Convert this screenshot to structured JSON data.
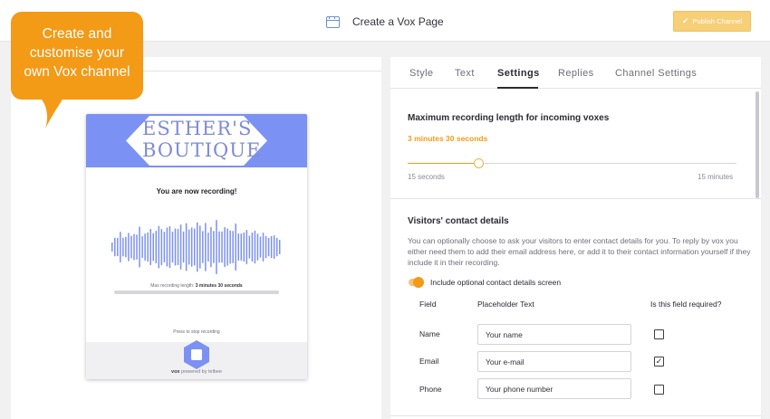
{
  "header": {
    "title": "Create a Vox Page",
    "publish_label": "Publish Channel",
    "title_icon": "browser-window-icon",
    "publish_icon": "check-icon"
  },
  "callout": {
    "lines": [
      "Create and",
      "customise your",
      "own Vox channel"
    ],
    "color": "#f39a17"
  },
  "preview": {
    "brand_line1": "ESTHER'S",
    "brand_line2": "BOUTIQUE",
    "recording_status": "You are now recording!",
    "max_length_label": "Max recording length:",
    "max_length_value": "3 minutes 30 seconds",
    "press_to_stop": "Press to stop recording",
    "powered_brand": "vox",
    "powered_by": "powered by telbee",
    "accent_color": "#7b91f3"
  },
  "settings": {
    "tabs": [
      "Style",
      "Text",
      "Settings",
      "Replies",
      "Channel Settings"
    ],
    "active_tab": "Settings",
    "recording": {
      "title": "Maximum recording length for incoming voxes",
      "value_label": "3 minutes 30 seconds",
      "slider_min": "15 seconds",
      "slider_max": "15 minutes",
      "slider_fraction": 0.217
    },
    "contact": {
      "title": "Visitors' contact details",
      "description": "You can optionally choose to ask your visitors to enter contact details for you. To reply by vox you either need them to add their email address here, or add it to their contact information yourself if they include it in their recording.",
      "toggle_label": "Include optional contact details screen",
      "toggle_on": true,
      "columns": [
        "Field",
        "Placeholder Text",
        "Is this field required?"
      ],
      "rows": [
        {
          "field": "Name",
          "placeholder": "Your name",
          "required": false
        },
        {
          "field": "Email",
          "placeholder": "Your e-mail",
          "required": true
        },
        {
          "field": "Phone",
          "placeholder": "Your phone number",
          "required": false
        }
      ]
    }
  }
}
